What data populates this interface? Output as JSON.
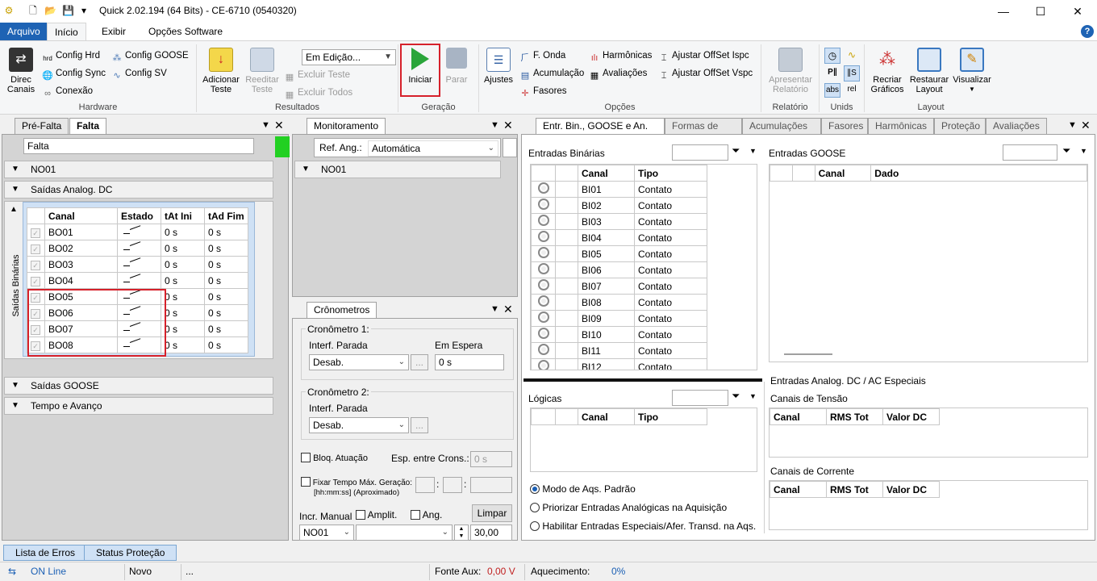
{
  "window": {
    "title": "Quick 2.02.194 (64 Bits) - CE-6710 (0540320)",
    "min": "—",
    "max": "☐",
    "close": "✕"
  },
  "menu": {
    "tabs": [
      "Arquivo",
      "Início",
      "Exibir",
      "Opções Software"
    ],
    "help": "?"
  },
  "ribbon": {
    "hardware": {
      "label": "Hardware",
      "direc": "Direc\nCanais",
      "config_hrd": "Config Hrd",
      "config_sync": "Config Sync",
      "conexao": "Conexão",
      "config_goose": "Config GOOSE",
      "config_sv": "Config SV"
    },
    "resultados": {
      "label": "Resultados",
      "adicionar": "Adicionar\nTeste",
      "reeditar": "Reeditar\nTeste",
      "mode": "Em Edição...",
      "excluir_teste": "Excluir Teste",
      "excluir_todos": "Excluir Todos"
    },
    "geracao": {
      "label": "Geração",
      "iniciar": "Iniciar",
      "parar": "Parar"
    },
    "opcoes": {
      "label": "Opções",
      "ajustes": "Ajustes",
      "f_onda": "F. Onda",
      "acumulacao": "Acumulação",
      "fasores": "Fasores",
      "harmonicas": "Harmônicas",
      "avaliacoes": "Avaliações",
      "offset_ispc": "Ajustar OffSet Ispc",
      "offset_vspc": "Ajustar OffSet Vspc"
    },
    "relatorio": {
      "label": "Relatório",
      "apresentar": "Apresentar\nRelatório"
    },
    "unids": {
      "label": "Unids",
      "abs": "abs",
      "rel": "rel"
    },
    "layout": {
      "label": "Layout",
      "recriar": "Recriar\nGráficos",
      "restaurar": "Restaurar\nLayout",
      "visualizar": "Visualizar"
    }
  },
  "left": {
    "tabs": [
      "Pré-Falta",
      "Falta"
    ],
    "state_name": "Falta",
    "sections": {
      "no01": "NO01",
      "saidas_dc": "Saídas Analog. DC",
      "saidas_goose": "Saídas GOOSE",
      "tempo": "Tempo e Avanço"
    },
    "vertical_label": "Saídas Binárias",
    "table": {
      "headers": [
        "Canal",
        "Estado",
        "tAt Ini",
        "tAd Fim"
      ],
      "rows": [
        [
          "BO01",
          "0 s",
          "0 s"
        ],
        [
          "BO02",
          "0 s",
          "0 s"
        ],
        [
          "BO03",
          "0 s",
          "0 s"
        ],
        [
          "BO04",
          "0 s",
          "0 s"
        ],
        [
          "BO05",
          "0 s",
          "0 s"
        ],
        [
          "BO06",
          "0 s",
          "0 s"
        ],
        [
          "BO07",
          "0 s",
          "0 s"
        ],
        [
          "BO08",
          "0 s",
          "0 s"
        ]
      ]
    }
  },
  "monitor": {
    "tab": "Monitoramento",
    "ref_label": "Ref. Ang.:",
    "ref_value": "Automática",
    "node": "NO01"
  },
  "crono": {
    "tab": "Crônometros",
    "c1": "Cronômetro 1:",
    "c2": "Cronômetro 2:",
    "interf": "Interf. Parada",
    "desab": "Desab.",
    "em_espera": "Em Espera",
    "espera_val": "0 s",
    "bloq": "Bloq. Atuação",
    "esp": "Esp. entre Crons.:",
    "esp_val": "0 s",
    "fixar": "Fixar Tempo Máx. Geração:",
    "fixar2": "[hh:mm:ss] (Aproximado)",
    "incr": "Incr. Manual",
    "amplit": "Amplit.",
    "ang": "Ang.",
    "limpar": "Limpar",
    "no": "NO01",
    "value": "30,00",
    "dots": "..."
  },
  "right": {
    "tabs": [
      "Entr. Bin., GOOSE e An. DC",
      "Formas de Onda",
      "Acumulações",
      "Fasores",
      "Harmônicas",
      "Proteção",
      "Avaliações"
    ],
    "entradas_bin": "Entradas Binárias",
    "entradas_goose": "Entradas GOOSE",
    "bin_headers": [
      "Canal",
      "Tipo"
    ],
    "goose_headers": [
      "Canal",
      "Dado"
    ],
    "bin_rows": [
      [
        "BI01",
        "Contato"
      ],
      [
        "BI02",
        "Contato"
      ],
      [
        "BI03",
        "Contato"
      ],
      [
        "BI04",
        "Contato"
      ],
      [
        "BI05",
        "Contato"
      ],
      [
        "BI06",
        "Contato"
      ],
      [
        "BI07",
        "Contato"
      ],
      [
        "BI08",
        "Contato"
      ],
      [
        "BI09",
        "Contato"
      ],
      [
        "BI10",
        "Contato"
      ],
      [
        "BI11",
        "Contato"
      ],
      [
        "BI12",
        "Contato"
      ]
    ],
    "logicas": "Lógicas",
    "log_headers": [
      "Canal",
      "Tipo"
    ],
    "analog": "Entradas Analog. DC / AC Especiais",
    "tensao": "Canais de Tensão",
    "corrente": "Canais de Corrente",
    "an_headers": [
      "Canal",
      "RMS Tot",
      "Valor DC"
    ],
    "radios": [
      "Modo de Aqs. Padrão",
      "Priorizar Entradas Analógicas na Aquisição",
      "Habilitar Entradas Especiais/Afer. Transd. na Aqs."
    ]
  },
  "bottom_tabs": [
    "Lista de Erros",
    "Status Proteção"
  ],
  "status": {
    "online": "ON Line",
    "novo": "Novo",
    "dots": "...",
    "fonte_label": "Fonte Aux:",
    "fonte_val": "0,00 V",
    "aquec_label": "Aquecimento:",
    "aquec_val": "0%"
  }
}
